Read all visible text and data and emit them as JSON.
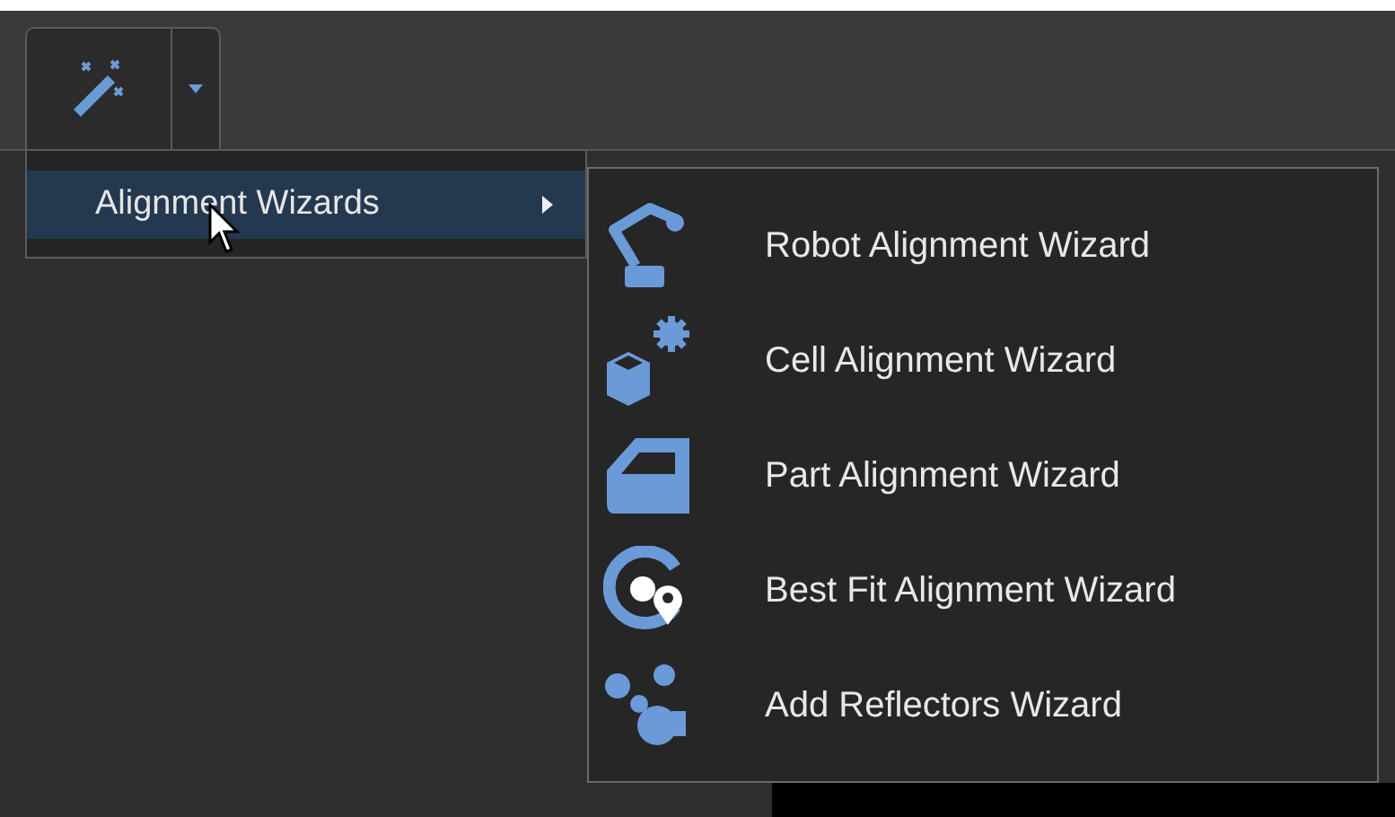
{
  "toolbar": {
    "wizard_button": {
      "selected": true
    }
  },
  "menu": {
    "items": [
      {
        "label": "Alignment Wizards",
        "selected": true,
        "has_submenu": true
      }
    ]
  },
  "submenu": {
    "items": [
      {
        "label": "Robot Alignment Wizard",
        "kind": "robot"
      },
      {
        "label": "Cell Alignment Wizard",
        "kind": "cell"
      },
      {
        "label": "Part Alignment Wizard",
        "kind": "part"
      },
      {
        "label": "Best Fit Alignment Wizard",
        "kind": "bestfit"
      },
      {
        "label": "Add Reflectors Wizard",
        "kind": "reflectors"
      }
    ]
  }
}
